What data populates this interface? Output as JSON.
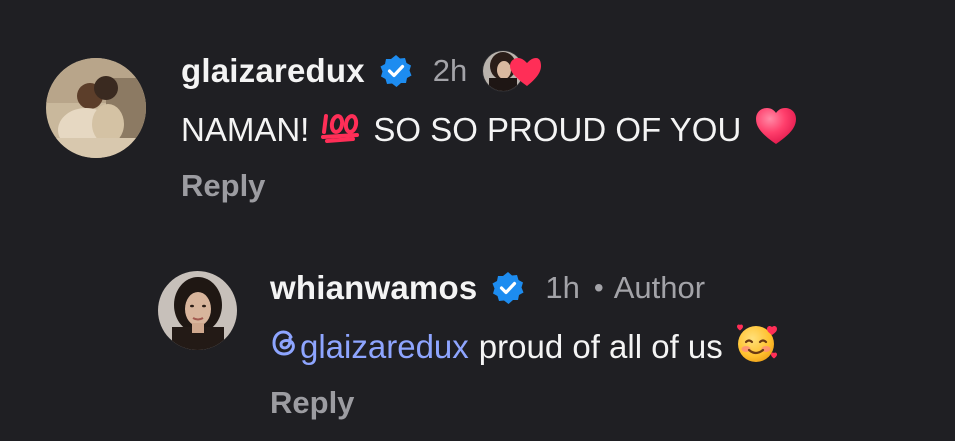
{
  "comments": [
    {
      "username": "glaizaredux",
      "timestamp": "2h",
      "text_before": "NAMAN!",
      "text_after": "SO SO PROUD OF YOU",
      "reply_label": "Reply",
      "verified": true,
      "liked_by_author": true
    },
    {
      "username": "whianwamos",
      "timestamp": "1h",
      "separator": "•",
      "author_badge": "Author",
      "mention": "glaizaredux",
      "text": "proud of all of us",
      "reply_label": "Reply",
      "verified": true
    }
  ],
  "colors": {
    "background": "#1f1f23",
    "verified_blue": "#1d8cf0",
    "mention": "#8ea5ff",
    "heart_red": "#ff2e57"
  },
  "icons": {
    "verified": "verified-badge-icon",
    "hundred": "hundred-points-emoji-icon",
    "heart": "heart-emoji-icon",
    "smiling_hearts": "smiling-face-with-hearts-emoji-icon",
    "threads": "threads-at-icon",
    "liked": "heart-like-icon"
  }
}
